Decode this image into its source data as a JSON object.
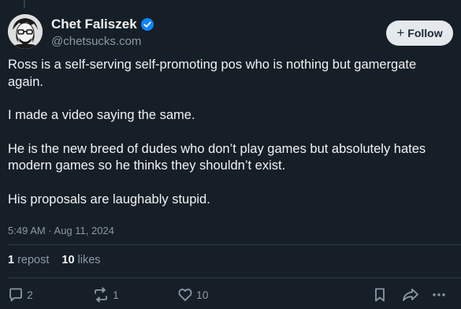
{
  "author": {
    "name": "Chet Faliszek",
    "handle": "@chetsucks.com",
    "verified": true,
    "avatar_icon": "avatar-portrait"
  },
  "follow": {
    "label": "Follow"
  },
  "post": {
    "paragraphs": [
      "Ross is a self-serving self-promoting pos who is nothing but gamergate again.",
      "I made a video saying the same.",
      "He is the new breed of dudes who don’t play games but absolutely hates modern games so he thinks they shouldn’t exist.",
      "His proposals are laughably stupid."
    ],
    "timestamp": "5:49 AM · Aug 11, 2024"
  },
  "stats": {
    "reposts_count": "1",
    "reposts_label": "repost",
    "likes_count": "10",
    "likes_label": "likes"
  },
  "actions": {
    "reply_count": "2",
    "repost_count": "1",
    "like_count": "10"
  },
  "colors": {
    "background": "#161e27",
    "text": "#f1f3f5",
    "muted": "#8b98a6",
    "verified": "#1083fe",
    "follow_bg": "#e5e8ec"
  }
}
